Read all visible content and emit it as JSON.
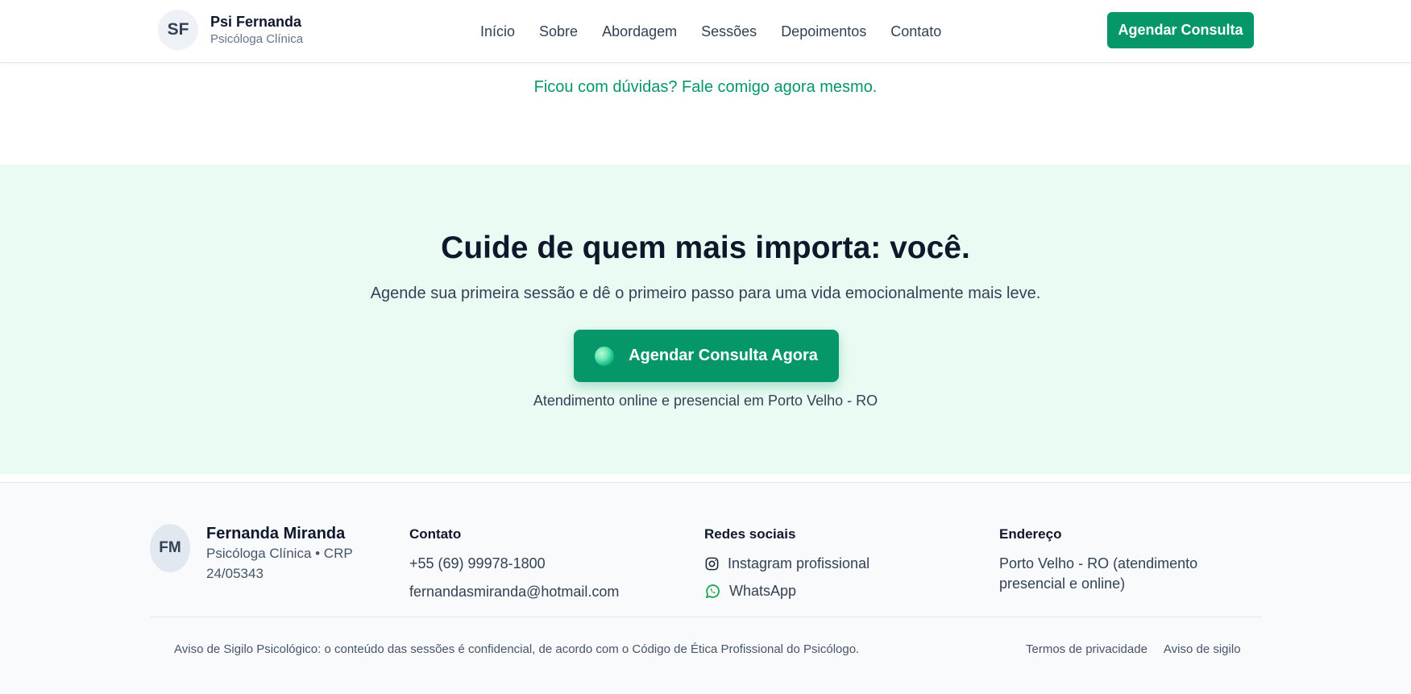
{
  "header": {
    "avatar_initials": "SF",
    "brand_name": "Psi Fernanda",
    "brand_subtitle": "Psicóloga Clínica",
    "nav": [
      "Início",
      "Sobre",
      "Abordagem",
      "Sessões",
      "Depoimentos",
      "Contato"
    ],
    "cta_label": "Agendar Consulta"
  },
  "question_link": "Ficou com dúvidas? Fale comigo agora mesmo.",
  "cta_section": {
    "title": "Cuide de quem mais importa: você.",
    "subtitle": "Agende sua primeira sessão e dê o primeiro passo para uma vida emocionalmente mais leve.",
    "button_label": "Agendar Consulta Agora",
    "note": "Atendimento online e presencial em Porto Velho - RO"
  },
  "footer": {
    "avatar_initials": "FM",
    "name": "Fernanda Miranda",
    "description": "Psicóloga Clínica • CRP 24/05343",
    "contact": {
      "heading": "Contato",
      "phone": "+55 (69) 99978-1800",
      "email": "fernandasmiranda@hotmail.com"
    },
    "social": {
      "heading": "Redes sociais",
      "instagram": "Instagram profissional",
      "whatsapp": "WhatsApp"
    },
    "address": {
      "heading": "Endereço",
      "text": "Porto Velho - RO (atendimento presencial e online)"
    },
    "notice": "Aviso de Sigilo Psicológico: o conteúdo das sessões é confidencial, de acordo com o Código de Ética Profissional do Psicólogo.",
    "links": [
      "Termos de privacidade",
      "Aviso de sigilo"
    ]
  },
  "colors": {
    "accent": "#059669",
    "cta_background": "#eafbf3",
    "footer_background": "#f8fafc",
    "heading": "#0f172a"
  },
  "icons": {
    "instagram": "instagram-icon",
    "whatsapp": "whatsapp-icon"
  }
}
